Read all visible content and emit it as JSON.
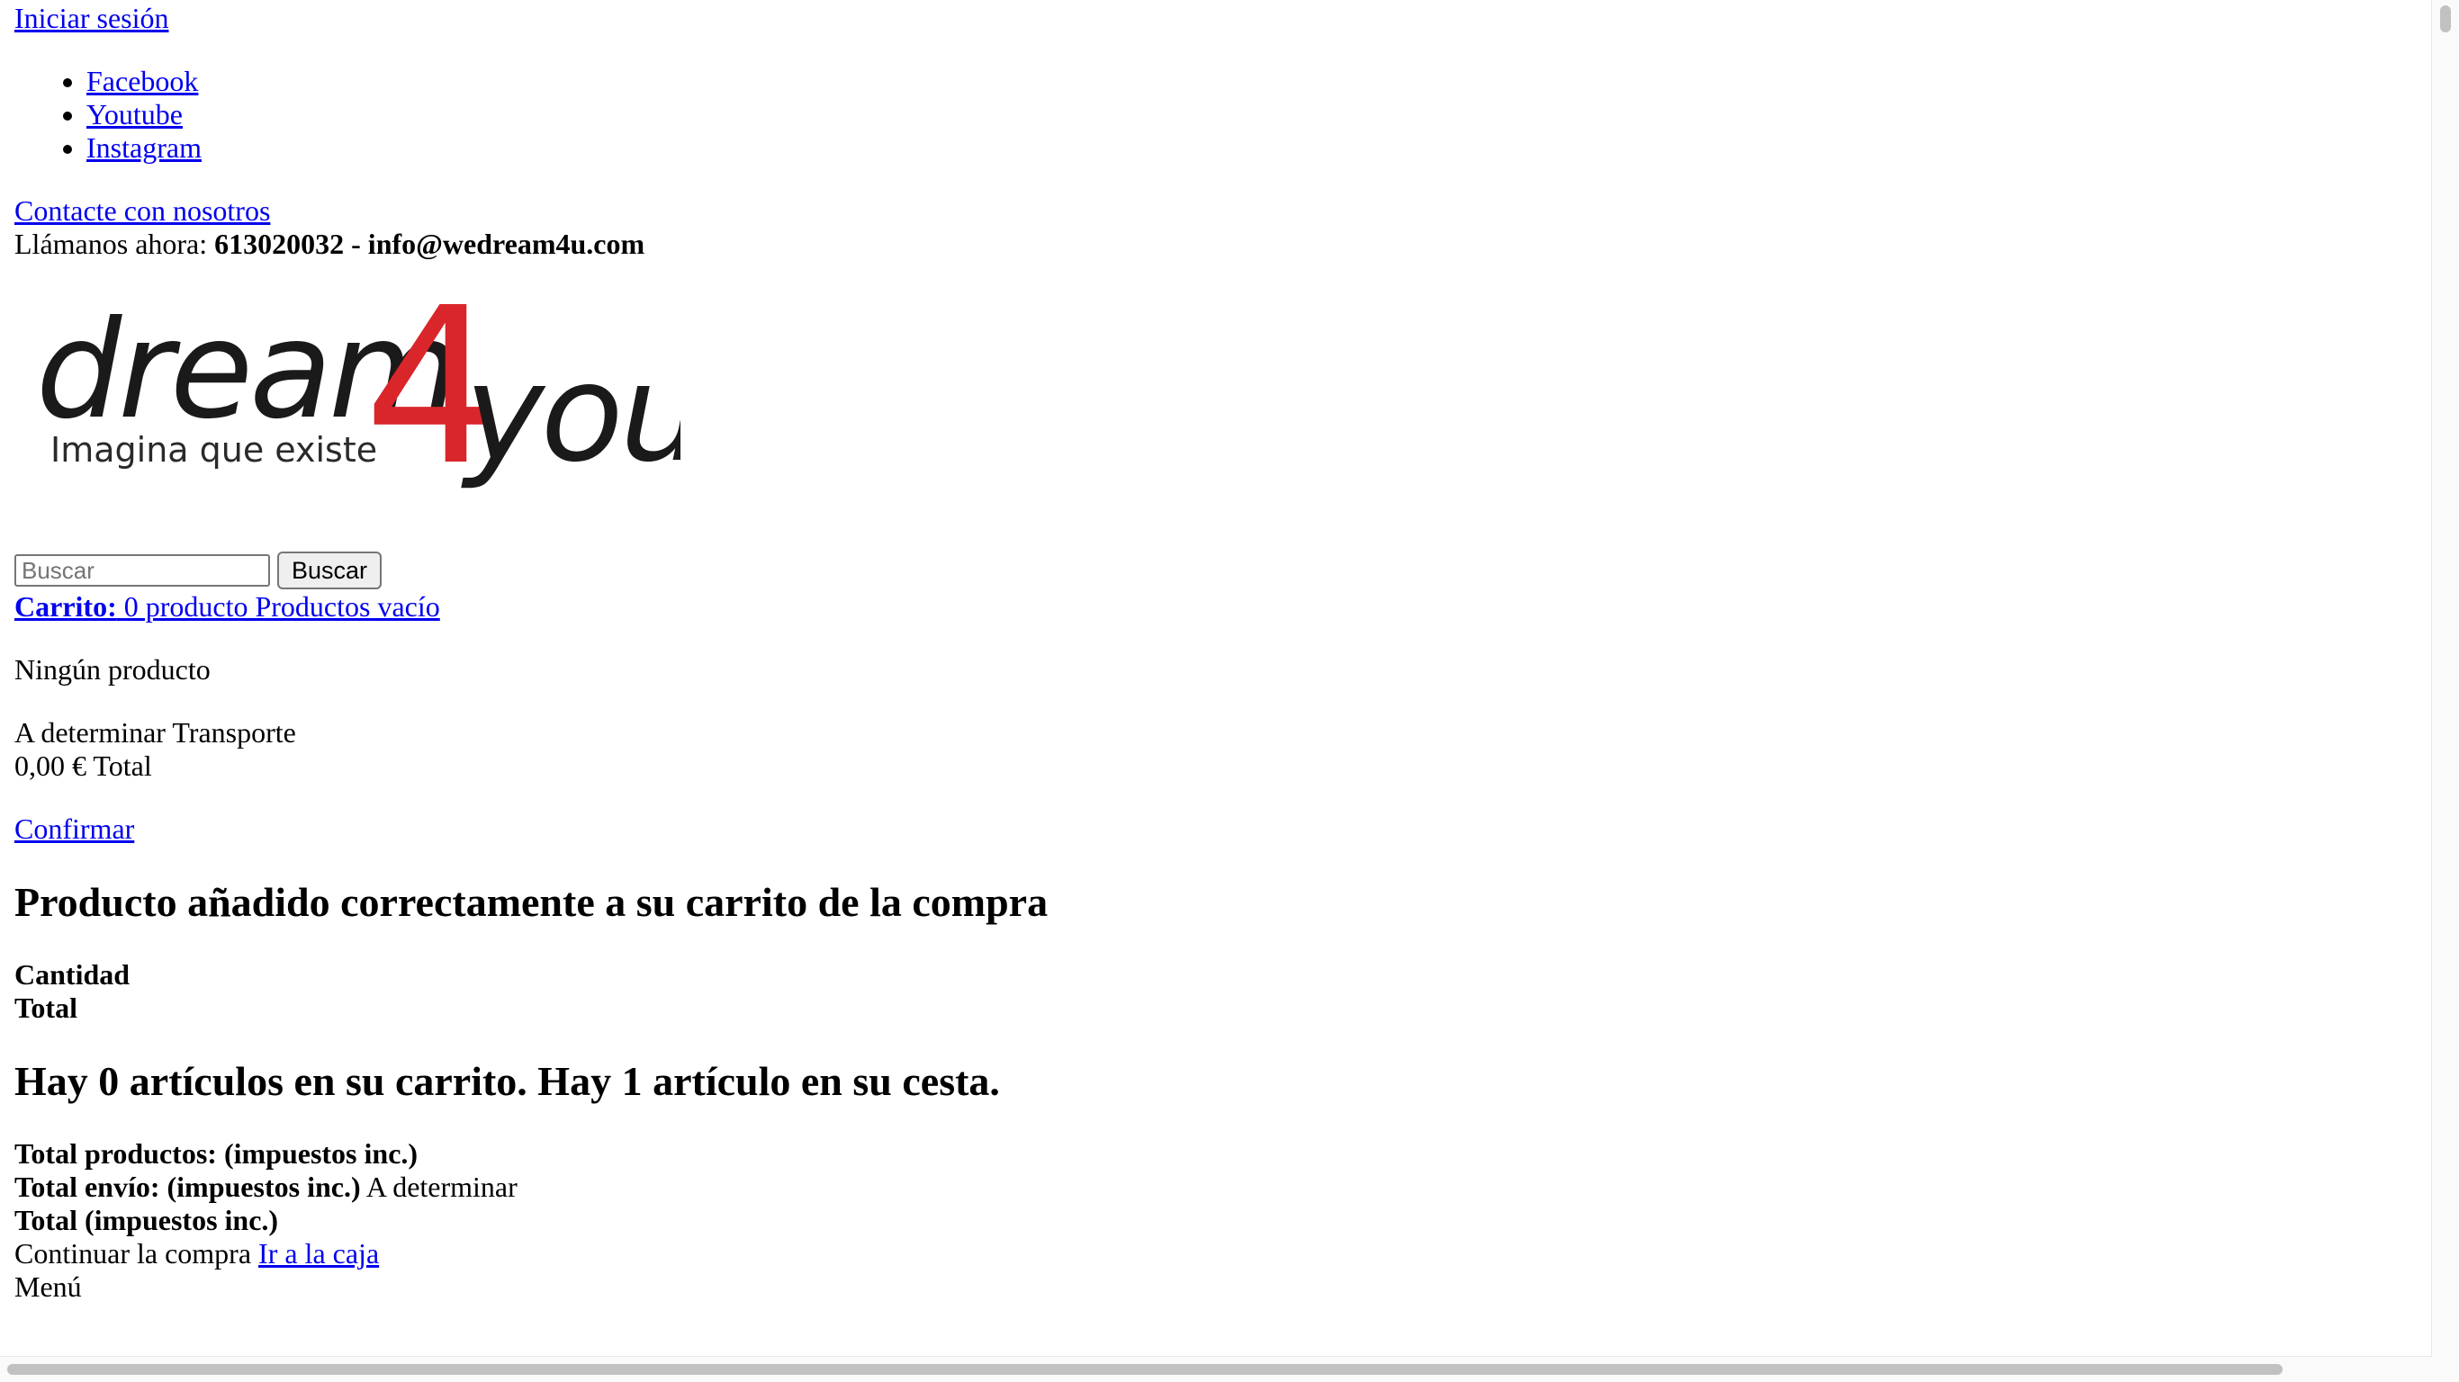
{
  "header": {
    "login_link": "Iniciar sesión",
    "social_links": [
      "Facebook",
      "Youtube",
      "Instagram"
    ],
    "contact_link": "Contacte con nosotros",
    "call_label": "Llámanos ahora: ",
    "call_value": "613020032 - info@wedream4u.com"
  },
  "logo": {
    "word_main": "dream",
    "digit": "4",
    "word_tail": "you",
    "tagline": "Imagina que existe",
    "colors": {
      "text": "#1a1a1a",
      "digit": "#d9262b"
    }
  },
  "search": {
    "placeholder": "Buscar",
    "button_label": "Buscar"
  },
  "cart": {
    "label": "Carrito:",
    "summary": " 0 producto Productos vacío",
    "no_product": "Ningún producto",
    "shipping_value": "A determinar",
    "shipping_label": " Transporte",
    "total_value": "0,00 €",
    "total_label": " Total",
    "confirm_link": "Confirmar"
  },
  "layer_cart": {
    "added_title": "Producto añadido correctamente a su carrito de la compra",
    "quantity_label": "Cantidad",
    "total_label": "Total",
    "count_title": "Hay 0 artículos en su carrito. Hay 1 artículo en su cesta.",
    "total_products_label": "Total productos: (impuestos inc.)",
    "total_shipping_label": "Total envío: (impuestos inc.)",
    "total_shipping_value": " A determinar",
    "total_taxes_label": "Total (impuestos inc.)",
    "continue_label": "Continuar la compra ",
    "checkout_link": "Ir a la caja"
  },
  "menu": {
    "label": "Menú"
  },
  "colors": {
    "link": "#0000ee",
    "scrollbar_thumb": "#c1c1c1"
  }
}
